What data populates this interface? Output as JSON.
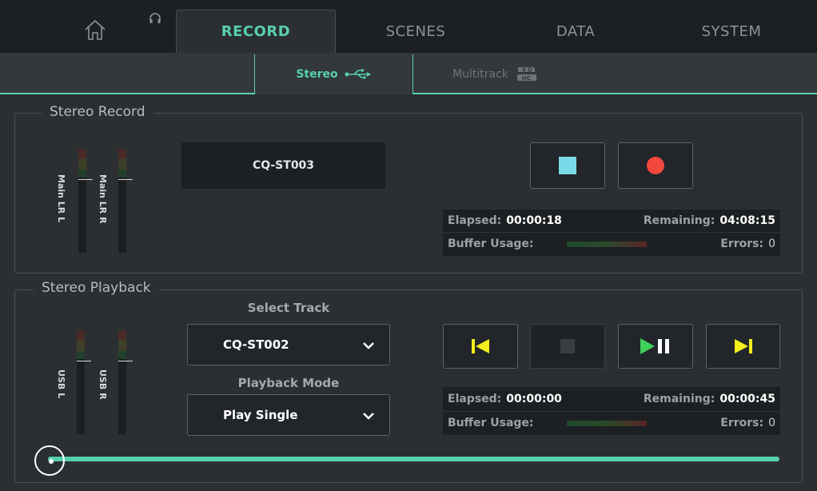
{
  "tabs": [
    {
      "label": "RECORD",
      "active": true
    },
    {
      "label": "SCENES",
      "active": false
    },
    {
      "label": "DATA",
      "active": false
    },
    {
      "label": "SYSTEM",
      "active": false
    }
  ],
  "subtabs": [
    {
      "label": "Stereo",
      "icon": "usb-icon",
      "active": true
    },
    {
      "label": "Multitrack",
      "icon": "sd-hc-card-icon",
      "active": false
    }
  ],
  "colors": {
    "accent": "#57d0b0",
    "record": "#f2483d",
    "stop": "#7ad9e6",
    "transport": "#f5ee1c",
    "play": "#3fd15a"
  },
  "record": {
    "title": "Stereo Record",
    "meters": [
      "Main LR L",
      "Main LR R"
    ],
    "filename": "CQ-ST003",
    "elapsed_label": "Elapsed:",
    "elapsed": "00:00:18",
    "remaining_label": "Remaining:",
    "remaining": "04:08:15",
    "buffer_label": "Buffer Usage:",
    "errors_label": "Errors:",
    "errors": "0"
  },
  "playback": {
    "title": "Stereo Playback",
    "meters": [
      "USB L",
      "USB R"
    ],
    "select_track_label": "Select Track",
    "track": "CQ-ST002",
    "mode_label": "Playback Mode",
    "mode": "Play Single",
    "elapsed_label": "Elapsed:",
    "elapsed": "00:00:00",
    "remaining_label": "Remaining:",
    "remaining": "00:00:45",
    "buffer_label": "Buffer Usage:",
    "errors_label": "Errors:",
    "errors": "0",
    "position": 0
  }
}
